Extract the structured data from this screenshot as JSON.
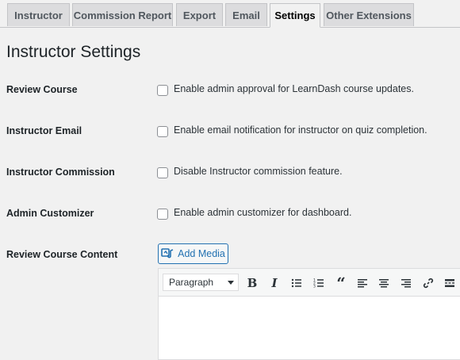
{
  "tabs": [
    {
      "label": "Instructor"
    },
    {
      "label": "Commission Report"
    },
    {
      "label": "Export"
    },
    {
      "label": "Email"
    },
    {
      "label": "Settings",
      "active": true
    },
    {
      "label": "Other Extensions"
    }
  ],
  "page_title": "Instructor Settings",
  "settings": [
    {
      "label": "Review Course",
      "option": "Enable admin approval for LearnDash course updates.",
      "checked": false
    },
    {
      "label": "Instructor Email",
      "option": "Enable email notification for instructor on quiz completion.",
      "checked": false
    },
    {
      "label": "Instructor Commission",
      "option": "Disable Instructor commission feature.",
      "checked": false
    },
    {
      "label": "Admin Customizer",
      "option": "Enable admin customizer for dashboard.",
      "checked": false
    }
  ],
  "review_content": {
    "label": "Review Course Content",
    "add_media_label": "Add Media",
    "format_select": "Paragraph",
    "toolbar_icons": [
      "bold-icon",
      "italic-icon",
      "bulleted-list-icon",
      "numbered-list-icon",
      "blockquote-icon",
      "align-left-icon",
      "align-center-icon",
      "align-right-icon",
      "link-icon",
      "read-more-icon"
    ]
  },
  "colors": {
    "accent": "#2271b1",
    "background": "#f1f1f1"
  }
}
